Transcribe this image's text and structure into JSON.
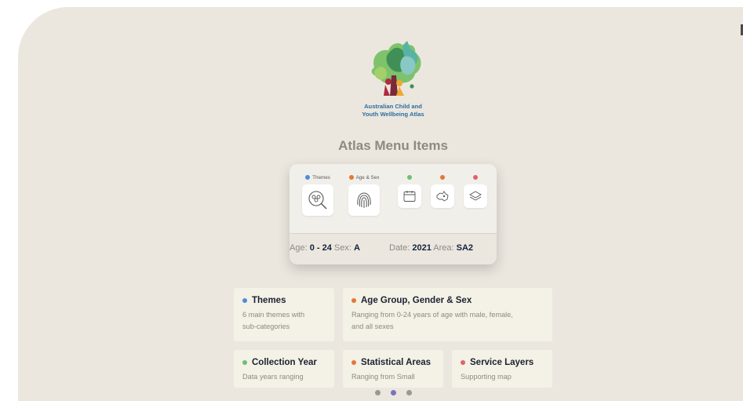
{
  "logo": {
    "line1": "Australian Child and",
    "line2": "Youth Wellbeing Atlas"
  },
  "heading": "Atlas Menu Items",
  "menu": {
    "tools": [
      {
        "label": "Themes",
        "color": "#4e8ed6",
        "icon": "search-people-icon"
      },
      {
        "label": "Age & Sex",
        "color": "#e27a34",
        "icon": "fingerprint-icon"
      },
      {
        "label": "",
        "color": "#6fbf72",
        "icon": "calendar-icon"
      },
      {
        "label": "",
        "color": "#e27a34",
        "icon": "australia-map-icon"
      },
      {
        "label": "",
        "color": "#e0626a",
        "icon": "layers-icon"
      }
    ],
    "status": {
      "age_label": "Age:",
      "age_value": "0 - 24",
      "sex_label": "Sex:",
      "sex_value": "A",
      "date_label": "Date:",
      "date_value": "2021",
      "area_label": "Area:",
      "area_value": "SA2"
    }
  },
  "cards": [
    {
      "title": "Themes",
      "color": "#4e8ed6",
      "desc": [
        "6 main themes with",
        "sub-categories"
      ]
    },
    {
      "title": "Age Group, Gender & Sex",
      "color": "#e27a34",
      "desc": [
        "Ranging from 0-24 years of age with male, female,",
        "and all sexes"
      ]
    },
    {
      "title": "Collection Year",
      "color": "#6fbf72",
      "desc": [
        "Data years ranging"
      ]
    },
    {
      "title": "Statistical Areas",
      "color": "#e27a34",
      "desc": [
        "Ranging from Small"
      ]
    },
    {
      "title": "Service Layers",
      "color": "#e0626a",
      "desc": [
        "Supporting map"
      ]
    }
  ],
  "pager": {
    "count": 3,
    "active_index": 1
  }
}
